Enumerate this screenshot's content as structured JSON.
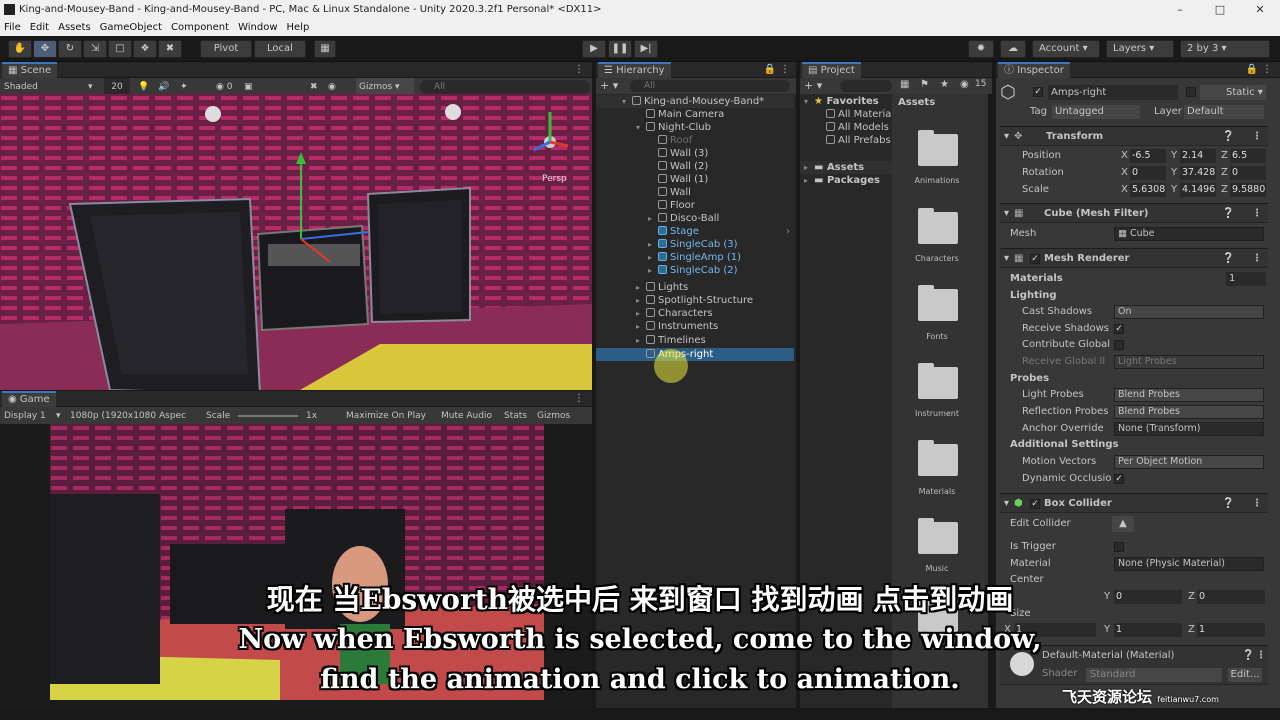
{
  "window": {
    "title": "King-and-Mousey-Band - King-and-Mousey-Band - PC, Mac & Linux Standalone - Unity 2020.3.2f1 Personal* <DX11>"
  },
  "menu": [
    "File",
    "Edit",
    "Assets",
    "GameObject",
    "Component",
    "Window",
    "Help"
  ],
  "toolbar": {
    "pivot": "Pivot",
    "local": "Local",
    "account": "Account",
    "layers": "Layers",
    "layout": "2 by 3"
  },
  "scene": {
    "tab": "Scene",
    "shading": "Shaded",
    "size": "20",
    "gizmos": "Gizmos",
    "search": "All",
    "persp": "Persp"
  },
  "game": {
    "tab": "Game",
    "display": "Display 1",
    "resolution": "1080p (1920x1080 Aspec",
    "scale_label": "Scale",
    "scale_value": "1x",
    "maximize": "Maximize On Play",
    "mute": "Mute Audio",
    "stats": "Stats",
    "gizmos": "Gizmos"
  },
  "hierarchy": {
    "tab": "Hierarchy",
    "search": "All",
    "items": [
      {
        "label": "King-and-Mousey-Band*"
      },
      {
        "label": "Main Camera"
      },
      {
        "label": "Night-Club"
      },
      {
        "label": "Roof"
      },
      {
        "label": "Wall (3)"
      },
      {
        "label": "Wall (2)"
      },
      {
        "label": "Wall (1)"
      },
      {
        "label": "Wall"
      },
      {
        "label": "Floor"
      },
      {
        "label": "Disco-Ball"
      },
      {
        "label": "Stage"
      },
      {
        "label": "SingleCab (3)"
      },
      {
        "label": "SingleAmp (1)"
      },
      {
        "label": "SingleCab (2)"
      },
      {
        "label": "Lights"
      },
      {
        "label": "Spotlight-Structure"
      },
      {
        "label": "Characters"
      },
      {
        "label": "Instruments"
      },
      {
        "label": "Timelines"
      },
      {
        "label": "Amps-right"
      }
    ]
  },
  "project": {
    "tab": "Project",
    "favorites": "Favorites",
    "fav_items": [
      "All Materia",
      "All Models",
      "All Prefabs"
    ],
    "assets": "Assets",
    "packages": "Packages",
    "assets_header": "Assets",
    "count": "15",
    "folders": [
      "Animations",
      "Characters",
      "Fonts",
      "Instrument",
      "Materials",
      "Music",
      "Scr"
    ]
  },
  "inspector": {
    "tab": "Inspector",
    "object_name": "Amps-right",
    "static": "Static",
    "tag_label": "Tag",
    "tag": "Untagged",
    "layer_label": "Layer",
    "layer": "Default",
    "transform": {
      "title": "Transform",
      "position": {
        "label": "Position",
        "x": "-6.5",
        "y": "2.14",
        "z": "6.5"
      },
      "rotation": {
        "label": "Rotation",
        "x": "0",
        "y": "37.428",
        "z": "0"
      },
      "scale": {
        "label": "Scale",
        "x": "5.6308",
        "y": "4.1496",
        "z": "9.5880"
      }
    },
    "mesh_filter": {
      "title": "Cube (Mesh Filter)",
      "mesh_label": "Mesh",
      "mesh": "Cube"
    },
    "mesh_renderer": {
      "title": "Mesh Renderer",
      "materials": "Materials",
      "materials_count": "1",
      "lighting": "Lighting",
      "cast_shadows": "Cast Shadows",
      "cast_shadows_value": "On",
      "receive_shadows": "Receive Shadows",
      "contribute_gi": "Contribute Global",
      "receive_gi": "Receive Global Il",
      "receive_gi_value": "Light Probes",
      "probes": "Probes",
      "light_probes": "Light Probes",
      "light_probes_value": "Blend Probes",
      "reflection_probes": "Reflection Probes",
      "reflection_probes_value": "Blend Probes",
      "anchor_override": "Anchor Override",
      "anchor_override_value": "None (Transform)",
      "additional": "Additional Settings",
      "motion_vectors": "Motion Vectors",
      "motion_vectors_value": "Per Object Motion",
      "dynamic_occlusion": "Dynamic Occlusio"
    },
    "box_collider": {
      "title": "Box Collider",
      "edit_collider": "Edit Collider",
      "is_trigger": "Is Trigger",
      "material_label": "Material",
      "material": "None (Physic Material)",
      "center": "Center",
      "size": "Size",
      "center_y": "0",
      "center_z": "0",
      "size_y": "1",
      "size_z": "1",
      "size_x": "1"
    },
    "material": {
      "name": "Default-Material (Material)",
      "shader_label": "Shader",
      "shader": "Standard",
      "edit": "Edit..."
    }
  },
  "subtitle": {
    "cn": "现在 当Ebsworth被选中后 来到窗口 找到动画 点击到动画",
    "en_line1": "Now when Ebsworth is selected, come to the window,",
    "en_line2": "find the animation and click to animation."
  },
  "watermark": {
    "text": "飞天资源论坛",
    "url": "feitianwu7.com"
  }
}
